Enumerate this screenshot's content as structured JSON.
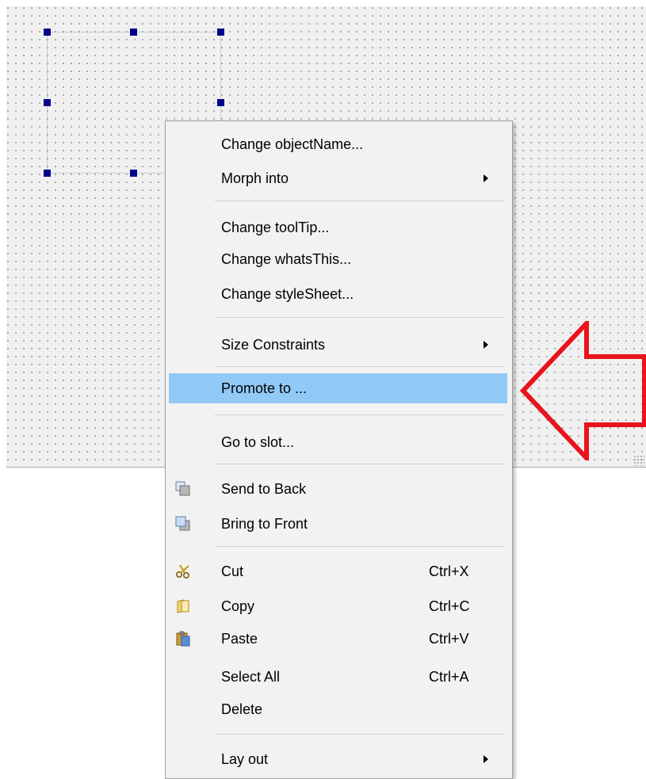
{
  "menu": {
    "change_objectname": "Change objectName...",
    "morph_into": "Morph into",
    "change_tooltip": "Change toolTip...",
    "change_whatsthis": "Change whatsThis...",
    "change_stylesheet": "Change styleSheet...",
    "size_constraints": "Size Constraints",
    "promote_to": "Promote to ...",
    "go_to_slot": "Go to slot...",
    "send_to_back": "Send to Back",
    "bring_to_front": "Bring to Front",
    "cut": "Cut",
    "cut_shortcut": "Ctrl+X",
    "copy": "Copy",
    "copy_shortcut": "Ctrl+C",
    "paste": "Paste",
    "paste_shortcut": "Ctrl+V",
    "select_all": "Select All",
    "select_all_shortcut": "Ctrl+A",
    "delete": "Delete",
    "lay_out": "Lay out"
  },
  "icons": {
    "send_to_back": "send-to-back-icon",
    "bring_to_front": "bring-to-front-icon",
    "cut": "scissors-icon",
    "copy": "copy-icon",
    "paste": "paste-icon",
    "submenu": "chevron-right-icon",
    "annotation": "left-arrow-annotation"
  },
  "colors": {
    "highlight": "#91c9f7",
    "annotation_arrow": "#e8131b",
    "selection_handle": "#00008b",
    "canvas": "#f0f0f0"
  }
}
